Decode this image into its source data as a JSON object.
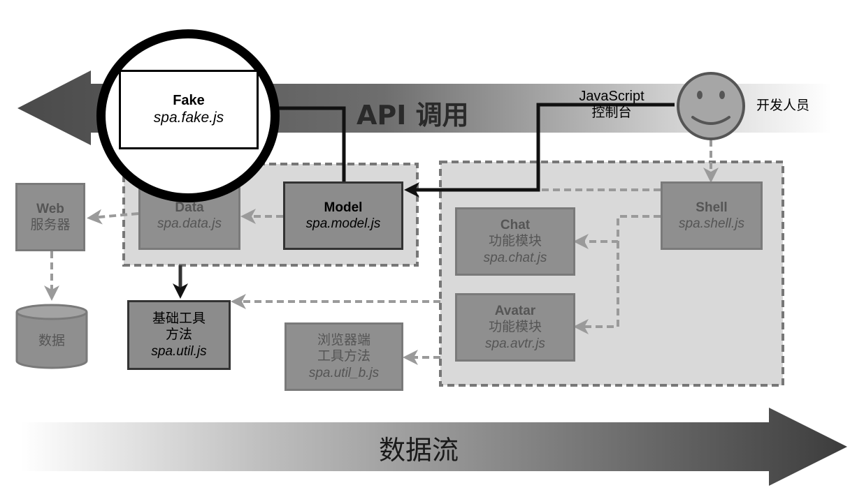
{
  "top_band": {
    "title": "API 调用"
  },
  "bottom_band": {
    "title": "数据流"
  },
  "fake": {
    "title": "Fake",
    "file": "spa.fake.js"
  },
  "model": {
    "title": "Model",
    "file": "spa.model.js"
  },
  "data_module": {
    "title": "Data",
    "file": "spa.data.js"
  },
  "web_server": {
    "title": "Web",
    "subtitle": "服务器"
  },
  "database": {
    "label": "数据"
  },
  "util": {
    "line1": "基础工具",
    "line2": "方法",
    "file": "spa.util.js"
  },
  "util_b": {
    "line1": "浏览器端",
    "line2": "工具方法",
    "file": "spa.util_b.js"
  },
  "chat": {
    "title": "Chat",
    "subtitle": "功能模块",
    "file": "spa.chat.js"
  },
  "avatar": {
    "title": "Avatar",
    "subtitle": "功能模块",
    "file": "spa.avtr.js"
  },
  "shell": {
    "title": "Shell",
    "file": "spa.shell.js"
  },
  "console": {
    "line1": "JavaScript",
    "line2": "控制台"
  },
  "developer": {
    "label": "开发人员"
  }
}
